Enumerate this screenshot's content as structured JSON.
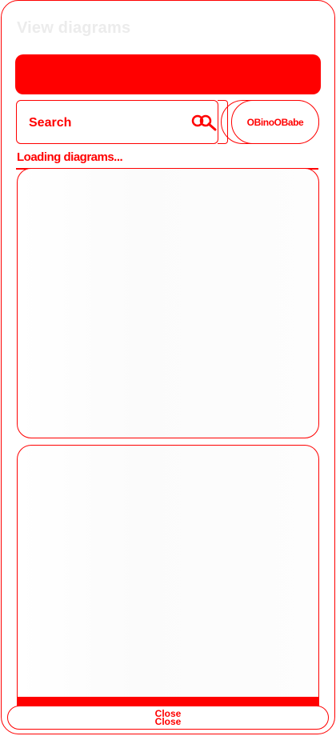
{
  "dialog": {
    "title": "View diagrams"
  },
  "search": {
    "placeholder": "Search"
  },
  "toolbar": {
    "open_label": "OBinoOBabe"
  },
  "status": {
    "loading_text": "Loading diagrams..."
  },
  "footer": {
    "close_label": "Close"
  },
  "colors": {
    "accent": "#ff0000",
    "title": "#ececec",
    "background": "#ffffff"
  },
  "icons": {
    "search": "search-icon"
  }
}
